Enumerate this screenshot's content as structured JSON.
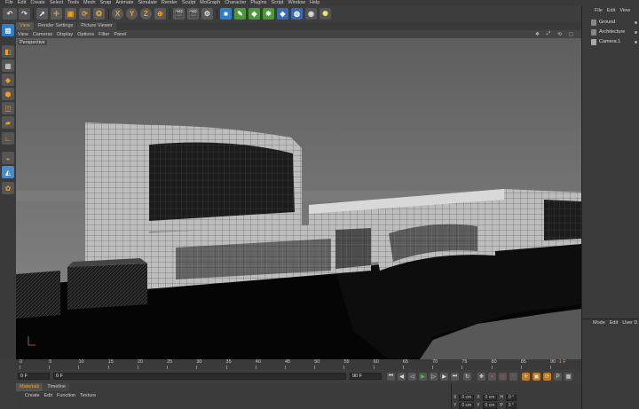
{
  "menubar": [
    "File",
    "Edit",
    "Create",
    "Select",
    "Tools",
    "Mesh",
    "Snap",
    "Animate",
    "Simulate",
    "Render",
    "Sculpt",
    "MoGraph",
    "Character",
    "Plugins",
    "Script",
    "Window",
    "Help"
  ],
  "toolbar": {
    "axis_labels": [
      "X",
      "Y",
      "Z"
    ]
  },
  "view_tabs": [
    "View",
    "Render Settings",
    "Picture Viewer"
  ],
  "viewport_menu": [
    "View",
    "Cameras",
    "Display",
    "Options",
    "Filter",
    "Panel"
  ],
  "viewport_label": "Perspective",
  "object_manager": {
    "menu": [
      "File",
      "Edit",
      "View"
    ],
    "objects": [
      "Ground",
      "Architecture",
      "Camera.1"
    ]
  },
  "attribute_manager": {
    "menu": [
      "Mode",
      "Edit",
      "User D"
    ]
  },
  "timeline": {
    "ticks": [
      "0",
      "5",
      "10",
      "15",
      "20",
      "25",
      "30",
      "35",
      "40",
      "45",
      "50",
      "55",
      "60",
      "65",
      "70",
      "75",
      "80",
      "85",
      "90"
    ],
    "current_frame": "0 F",
    "start_field": "0 F",
    "start_field2": "0 F",
    "end_field": "90 F",
    "end_field2": "90 F",
    "frame_readout": "-1 F"
  },
  "materials": {
    "tabs": [
      "Materials",
      "Timeline"
    ],
    "menu": [
      "Create",
      "Edit",
      "Function",
      "Texture"
    ]
  },
  "coordinates": {
    "rows": [
      {
        "a": "X",
        "av": "0 cm",
        "b": "X",
        "bv": "0 cm",
        "c": "H",
        "cv": "0 °"
      },
      {
        "a": "Y",
        "av": "0 cm",
        "b": "Y",
        "bv": "0 cm",
        "c": "P",
        "cv": "0 °"
      }
    ]
  },
  "colors": {
    "accent": "#f0a020",
    "viewport_bg": "#6d6d6d",
    "floor": "#000000"
  }
}
